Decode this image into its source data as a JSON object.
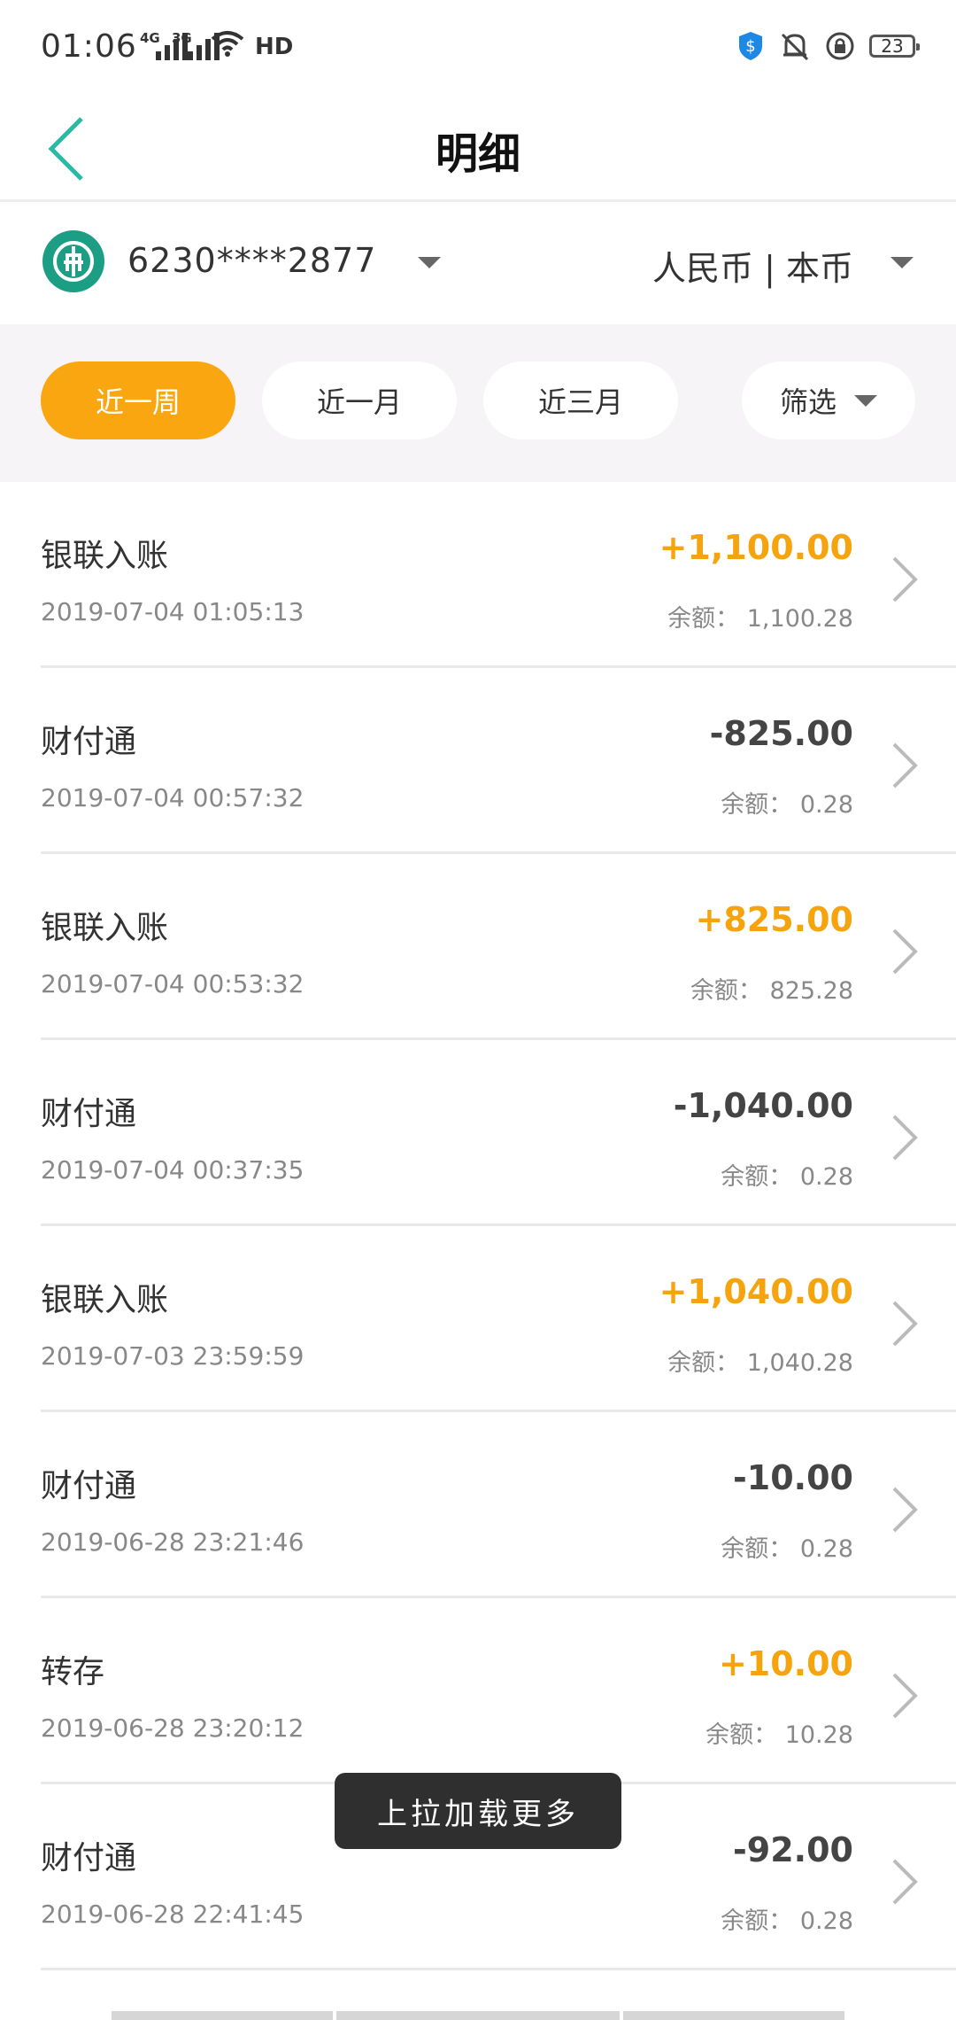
{
  "status_bar": {
    "time": "01:06",
    "signal1_label": "4G",
    "signal2_label": "3G",
    "hd_label": "HD",
    "battery_level": "23"
  },
  "header": {
    "title": "明细"
  },
  "account": {
    "number": "6230****2877",
    "currency": "人民币 | 本币"
  },
  "filters": {
    "week": "近一周",
    "month": "近一月",
    "three_months": "近三月",
    "filter": "筛选"
  },
  "transactions": [
    {
      "title": "银联入账",
      "date": "2019-07-04 01:05:13",
      "amount": "+1,100.00",
      "balance": "余额： 1,100.28"
    },
    {
      "title": "财付通",
      "date": "2019-07-04 00:57:32",
      "amount": "-825.00",
      "balance": "余额： 0.28"
    },
    {
      "title": "银联入账",
      "date": "2019-07-04 00:53:32",
      "amount": "+825.00",
      "balance": "余额： 825.28"
    },
    {
      "title": "财付通",
      "date": "2019-07-04 00:37:35",
      "amount": "-1,040.00",
      "balance": "余额： 0.28"
    },
    {
      "title": "银联入账",
      "date": "2019-07-03 23:59:59",
      "amount": "+1,040.00",
      "balance": "余额： 1,040.28"
    },
    {
      "title": "财付通",
      "date": "2019-06-28 23:21:46",
      "amount": "-10.00",
      "balance": "余额： 0.28"
    },
    {
      "title": "转存",
      "date": "2019-06-28 23:20:12",
      "amount": "+10.00",
      "balance": "余额： 10.28"
    },
    {
      "title": "财付通",
      "date": "2019-06-28 22:41:45",
      "amount": "-92.00",
      "balance": "余额： 0.28"
    }
  ],
  "toast": {
    "text": "上拉加载更多"
  },
  "colors": {
    "accent": "#f9a610",
    "positive_amount": "#f5a40d",
    "back_arrow": "#2ab9a4",
    "bank_logo": "#1b9e83"
  }
}
